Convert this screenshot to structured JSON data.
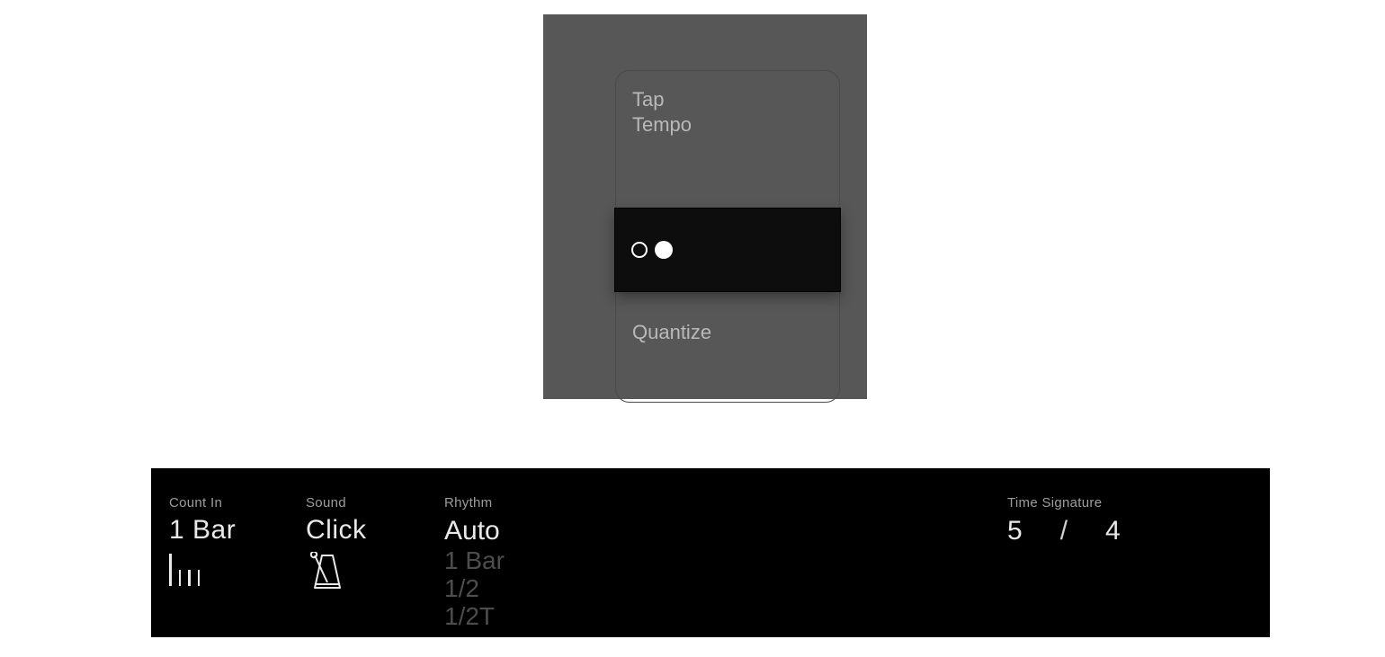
{
  "top_menu": {
    "items": [
      {
        "label": "Tap\nTempo"
      },
      {
        "label": ""
      },
      {
        "label": "Quantize"
      }
    ]
  },
  "bottom": {
    "count_in": {
      "label": "Count In",
      "value": "1 Bar"
    },
    "sound": {
      "label": "Sound",
      "value": "Click"
    },
    "rhythm": {
      "label": "Rhythm",
      "selected": "Auto",
      "options": [
        "Auto",
        "1 Bar",
        "1/2",
        "1/2T"
      ]
    },
    "time_signature": {
      "label": "Time Signature",
      "numerator": "5",
      "separator": "/",
      "denominator": "4"
    }
  }
}
